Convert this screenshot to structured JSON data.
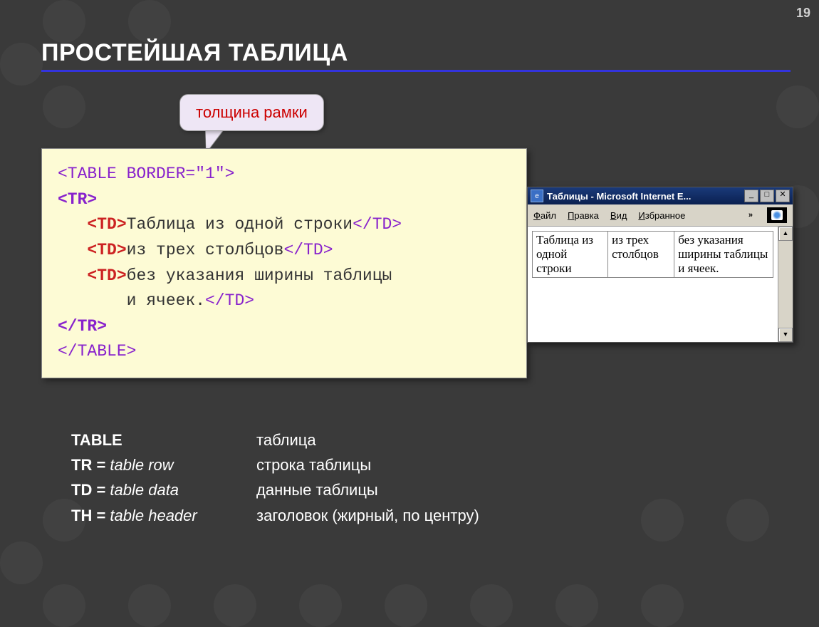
{
  "slide_number": "19",
  "title": "ПРОСТЕЙШАЯ ТАБЛИЦА",
  "callout": "толщина рамки",
  "code": {
    "l1_tag": "<TABLE BORDER=\"1\">",
    "l2_tag": "<TR>",
    "l3_tag": "<TD>",
    "l3_text": "Таблица из одной строки",
    "l3_close": "</TD>",
    "l4_tag": "<TD>",
    "l4_text": "из трех столбцов",
    "l4_close": "</TD>",
    "l5_tag": "<TD>",
    "l5_text": "без указания ширины таблицы",
    "l6_text": "и ячеек.",
    "l6_close": "</TD>",
    "l7_tag": "</TR>",
    "l8_tag": "</TABLE>"
  },
  "ie": {
    "title": "Таблицы - Microsoft Internet E...",
    "menu": {
      "file": "Файл",
      "edit": "Правка",
      "view": "Вид",
      "fav": "Избранное",
      "chev": "»"
    },
    "cells": [
      "Таблица из одной строки",
      "из трех столбцов",
      "без указания ширины таблицы и ячеек."
    ]
  },
  "defs": [
    {
      "term_b": "TABLE",
      "term_rest": "",
      "desc": "таблица"
    },
    {
      "term_b": "TR = ",
      "term_rest": "table row",
      "desc": "строка таблицы"
    },
    {
      "term_b": "TD = ",
      "term_rest": "table data",
      "desc": "данные таблицы"
    },
    {
      "term_b": "TH = ",
      "term_rest": "table header",
      "desc": "заголовок (жирный, по центру)"
    }
  ]
}
